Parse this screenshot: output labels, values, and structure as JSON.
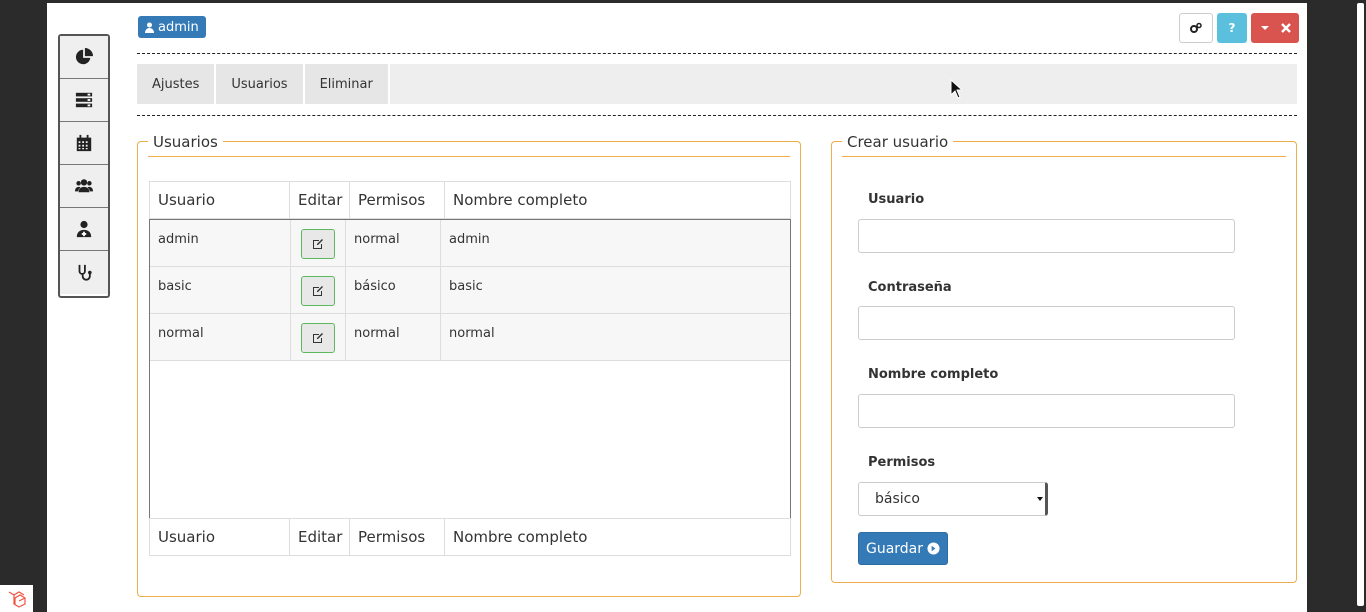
{
  "header": {
    "user_badge": "admin",
    "help_label": "?"
  },
  "sidebar": {
    "items": [
      {
        "icon": "pie-chart-icon"
      },
      {
        "icon": "server-icon"
      },
      {
        "icon": "calendar-icon"
      },
      {
        "icon": "users-icon"
      },
      {
        "icon": "user-md-icon"
      },
      {
        "icon": "stethoscope-icon"
      }
    ]
  },
  "tabs": [
    {
      "label": "Ajustes"
    },
    {
      "label": "Usuarios"
    },
    {
      "label": "Eliminar"
    }
  ],
  "users_panel": {
    "legend": "Usuarios",
    "columns": [
      "Usuario",
      "Editar",
      "Permisos",
      "Nombre completo"
    ],
    "rows": [
      {
        "usuario": "admin",
        "permisos": "normal",
        "nombre": "admin"
      },
      {
        "usuario": "basic",
        "permisos": "básico",
        "nombre": "basic"
      },
      {
        "usuario": "normal",
        "permisos": "normal",
        "nombre": "normal"
      }
    ]
  },
  "create_panel": {
    "legend": "Crear usuario",
    "usuario_label": "Usuario",
    "usuario_value": "",
    "password_label": "Contraseña",
    "password_value": "",
    "nombre_label": "Nombre completo",
    "nombre_value": "",
    "permisos_label": "Permisos",
    "permisos_selected": "básico",
    "save_label": "Guardar"
  },
  "colors": {
    "primary": "#337ab7",
    "info": "#5bc0de",
    "danger": "#d9534f",
    "warning_border": "#f0ad4e",
    "success_border": "#5cb85c"
  }
}
